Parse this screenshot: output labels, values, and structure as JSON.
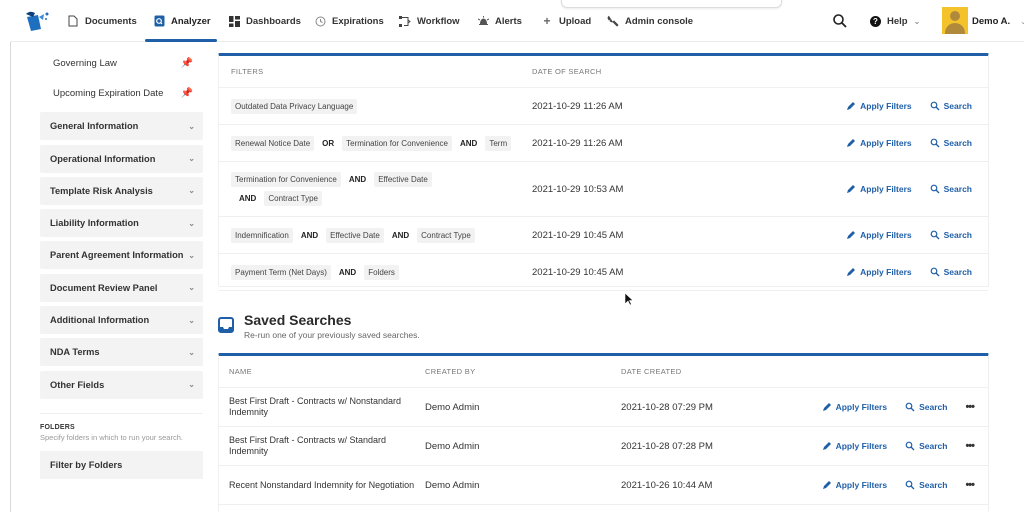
{
  "nav": {
    "items": [
      {
        "label": "Documents",
        "icon": "document-icon"
      },
      {
        "label": "Analyzer",
        "icon": "analyzer-icon",
        "active": true
      },
      {
        "label": "Dashboards",
        "icon": "dashboard-icon"
      },
      {
        "label": "Expirations",
        "icon": "clock-icon"
      },
      {
        "label": "Workflow",
        "icon": "workflow-icon"
      },
      {
        "label": "Alerts",
        "icon": "bell-icon"
      },
      {
        "label": "Upload",
        "icon": "plus-icon"
      },
      {
        "label": "Admin console",
        "icon": "wrench-icon"
      }
    ],
    "help_label": "Help",
    "user_name": "Demo A."
  },
  "sidebar": {
    "pinned": [
      {
        "label": "Governing Law"
      },
      {
        "label": "Upcoming Expiration Date"
      }
    ],
    "sections": [
      {
        "label": "General Information"
      },
      {
        "label": "Operational Information"
      },
      {
        "label": "Template Risk Analysis"
      },
      {
        "label": "Liability Information"
      },
      {
        "label": "Parent Agreement Information"
      },
      {
        "label": "Document Review Panel"
      },
      {
        "label": "Additional Information"
      },
      {
        "label": "NDA Terms"
      },
      {
        "label": "Other Fields"
      }
    ],
    "folders": {
      "title": "FOLDERS",
      "description": "Specify folders in which to run your search.",
      "button_label": "Filter by Folders"
    }
  },
  "recent_searches": {
    "columns": {
      "filters": "FILTERS",
      "date": "DATE OF SEARCH"
    },
    "actions": {
      "apply": "Apply Filters",
      "search": "Search"
    },
    "rows": [
      {
        "filters": [
          {
            "chip": "Outdated Data Privacy Language"
          }
        ],
        "date": "2021-10-29 11:26 AM"
      },
      {
        "filters": [
          {
            "chip": "Renewal Notice Date"
          },
          {
            "op": "OR"
          },
          {
            "chip": "Termination for Convenience"
          },
          {
            "op": "AND"
          },
          {
            "chip": "Term"
          }
        ],
        "date": "2021-10-29 11:26 AM"
      },
      {
        "filters": [
          {
            "chip": "Termination for Convenience"
          },
          {
            "op": "AND"
          },
          {
            "chip": "Effective Date"
          },
          {
            "op": "AND"
          },
          {
            "chip": "Contract Type"
          }
        ],
        "date": "2021-10-29 10:53 AM"
      },
      {
        "filters": [
          {
            "chip": "Indemnification"
          },
          {
            "op": "AND"
          },
          {
            "chip": "Effective Date"
          },
          {
            "op": "AND"
          },
          {
            "chip": "Contract Type"
          }
        ],
        "date": "2021-10-29 10:45 AM"
      },
      {
        "filters": [
          {
            "chip": "Payment Term (Net Days)"
          },
          {
            "op": "AND"
          },
          {
            "chip": "Folders"
          }
        ],
        "date": "2021-10-29 10:45 AM"
      }
    ]
  },
  "saved_searches": {
    "title": "Saved Searches",
    "subtitle": "Re-run one of your previously saved searches.",
    "columns": {
      "name": "NAME",
      "created_by": "CREATED BY",
      "date_created": "DATE CREATED"
    },
    "actions": {
      "apply": "Apply Filters",
      "search": "Search",
      "more": "•••"
    },
    "rows": [
      {
        "name": "Best First Draft - Contracts w/ Nonstandard Indemnity",
        "created_by": "Demo Admin",
        "date": "2021-10-28 07:29 PM"
      },
      {
        "name": "Best First Draft - Contracts w/ Standard Indemnity",
        "created_by": "Demo Admin",
        "date": "2021-10-28 07:28 PM"
      },
      {
        "name": "Recent Nonstandard Indemnity for Negotiation",
        "created_by": "Demo Admin",
        "date": "2021-10-26 10:44 AM"
      }
    ]
  },
  "colors": {
    "accent": "#1f5fa8",
    "chip_bg": "#f2f2f2",
    "accordion_bg": "#f3f3f3",
    "avatar_bg": "#f4c22b"
  }
}
